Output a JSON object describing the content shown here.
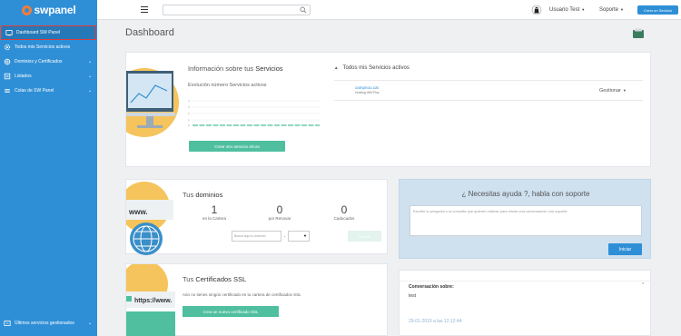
{
  "brand": {
    "logo_text": "swpanel"
  },
  "sidebar": {
    "items": [
      {
        "label": "Dashboard SW Panel",
        "icon": "dashboard-icon",
        "active": true
      },
      {
        "label": "Todos mis Servicios activos",
        "icon": "gear-icon"
      },
      {
        "label": "Dominios y Certificados",
        "icon": "globe-icon",
        "has_chevron": true
      },
      {
        "label": "Listados",
        "icon": "list-icon",
        "has_chevron": true
      },
      {
        "label": "Colas de SW Panel",
        "icon": "queue-icon",
        "has_chevron": true
      }
    ],
    "bottom_item": {
      "label": "Últimos servicios gestionados",
      "icon": "history-icon",
      "has_chevron": true
    }
  },
  "topbar": {
    "search_placeholder": "",
    "user_name": "Usuario Test",
    "support_label": "Soporte",
    "create_button": "Crear un Servicio"
  },
  "page": {
    "title": "Dashboard"
  },
  "services": {
    "title_prefix": "Información sobre tus ",
    "title_bold": "Servicios",
    "chart_subtitle": "Evolución número Servicios activos",
    "create_button": "Crear otro servicio ahora",
    "active_title": "Todos mis Servicios activos",
    "row": {
      "domain": "campnou.cat",
      "plan": "Hosting Wifi Plus",
      "action": "Gestionar"
    }
  },
  "domains": {
    "title_prefix": "Tus ",
    "title_bold": "dominios",
    "stats": [
      {
        "value": "1",
        "label": "en la Cartera"
      },
      {
        "value": "0",
        "label": "por Renovar"
      },
      {
        "value": "0",
        "label": "Caducados"
      }
    ],
    "input_placeholder": "Busca aquí tu dominio",
    "dot": ".",
    "search_button": "Buscar"
  },
  "ssl": {
    "title_prefix": "Tus ",
    "title_bold": "Certificados SSL",
    "text": "Aún no tienes ningún certificado en tu cartera de certificados SSL",
    "button": "Crea un nuevo certificado SSL",
    "illus_text": "https://www."
  },
  "help": {
    "title": "¿ Necesitas ayuda ?, habla con soporte",
    "placeholder": "Escribe tu pregunta o la consulta que quieres realizar para iniciar una conversación con soporte",
    "button": "Iniciar"
  },
  "conversation": {
    "title": "Conversación sobre:",
    "text": "test",
    "date": "29-01-2019 a las 12:12:44"
  },
  "domain_illus_text": "www.",
  "colors": {
    "primary": "#2f8fd6",
    "accent_green": "#4fbf9f",
    "active_border": "#e03c3c"
  }
}
